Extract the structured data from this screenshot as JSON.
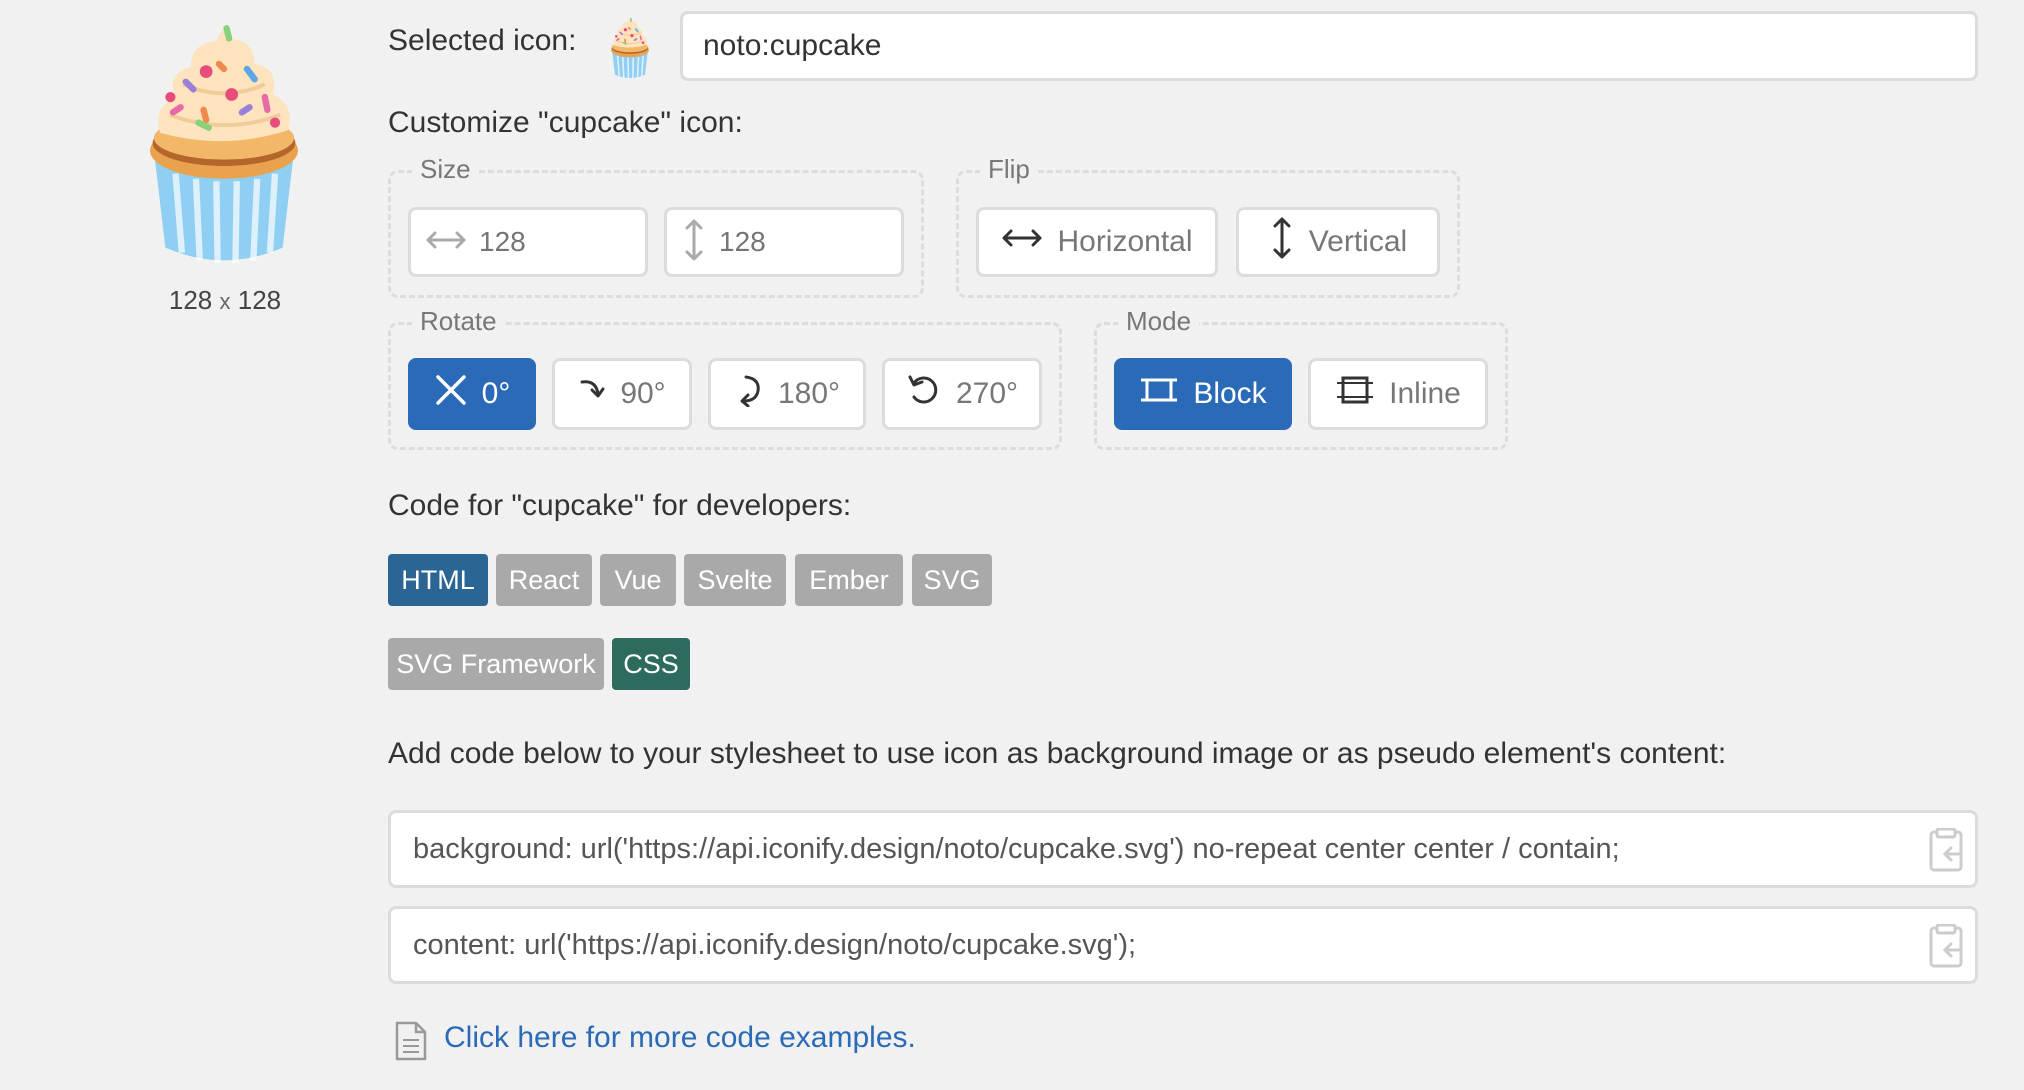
{
  "preview": {
    "icon": "cupcake-icon",
    "size_w": "128",
    "size_x": "x",
    "size_h": "128"
  },
  "selected": {
    "label": "Selected icon:",
    "value": "noto:cupcake"
  },
  "customize_title": "Customize \"cupcake\" icon:",
  "size": {
    "legend": "Size",
    "width_placeholder": "128",
    "height_placeholder": "128"
  },
  "flip": {
    "legend": "Flip",
    "horizontal": "Horizontal",
    "vertical": "Vertical"
  },
  "rotate": {
    "legend": "Rotate",
    "options": [
      "0°",
      "90°",
      "180°",
      "270°"
    ],
    "selected": "0°"
  },
  "mode": {
    "legend": "Mode",
    "block": "Block",
    "inline": "Inline",
    "selected": "Block"
  },
  "code_title": "Code for \"cupcake\" for developers:",
  "tabs": {
    "html": "HTML",
    "react": "React",
    "vue": "Vue",
    "svelte": "Svelte",
    "ember": "Ember",
    "svg": "SVG",
    "svg_framework": "SVG Framework",
    "css": "CSS"
  },
  "css_instructions": "Add code below to your stylesheet to use icon as background image or as pseudo element's content:",
  "code_lines": {
    "background": "background: url('https://api.iconify.design/noto/cupcake.svg') no-repeat center center / contain;",
    "content": "content: url('https://api.iconify.design/noto/cupcake.svg');"
  },
  "more_link": "Click here for more code examples.",
  "colors": {
    "accent": "#2a6ab7",
    "tab_active_html": "#2a6594",
    "tab_active_css": "#2d6b5f",
    "tab_inactive": "#a9a9a9",
    "background": "#f1f1f1"
  }
}
